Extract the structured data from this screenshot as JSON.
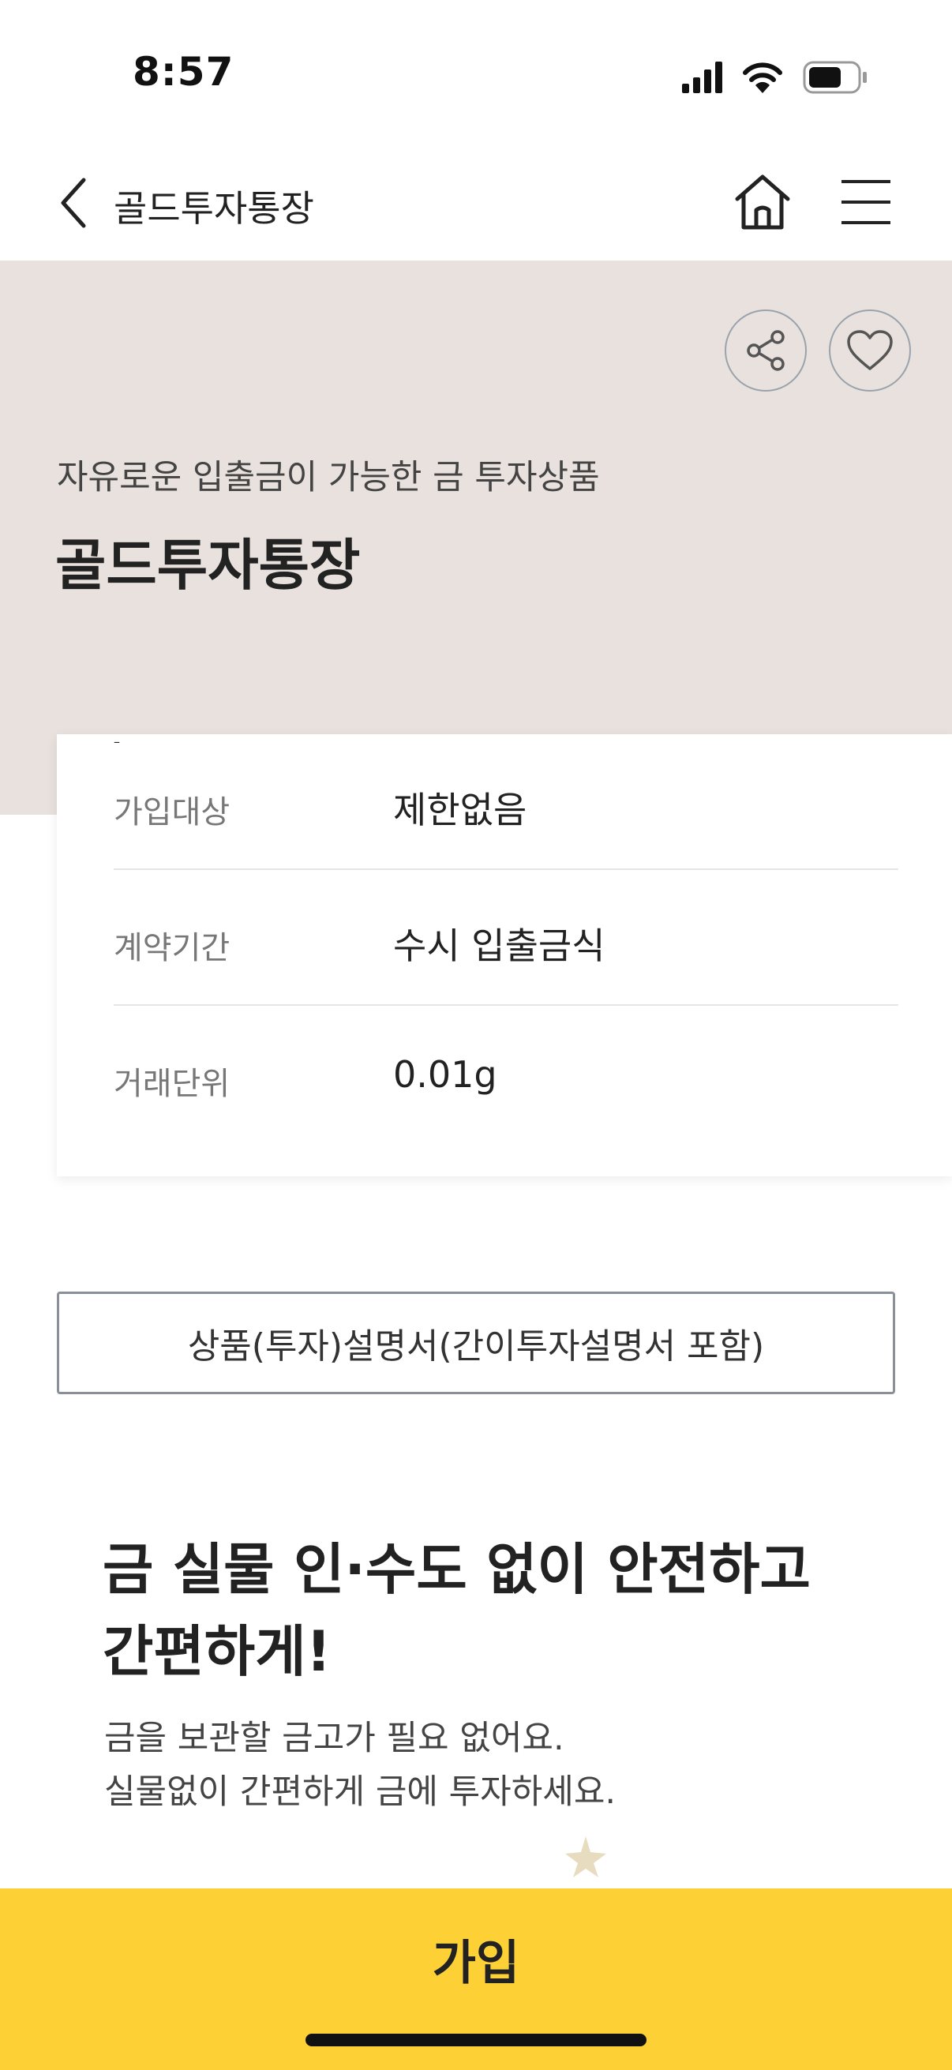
{
  "status_bar": {
    "time": "8:57",
    "icons": [
      "signal-icon",
      "wifi-icon",
      "battery-icon"
    ]
  },
  "nav": {
    "title": "골드투자통장",
    "icons": [
      "back-chevron-icon",
      "home-icon",
      "hamburger-menu-icon"
    ]
  },
  "hero": {
    "subtitle": "자유로운 입출금이 가능한 금 투자상품",
    "title": "골드투자통장",
    "background_color": "#e8e1dd",
    "actions": [
      "share-icon",
      "heart-icon"
    ]
  },
  "info": {
    "rows": [
      {
        "label": "가입대상",
        "value": "제한없음"
      },
      {
        "label": "계약기간",
        "value": "수시 입출금식"
      },
      {
        "label": "거래단위",
        "value": "0.01g"
      }
    ]
  },
  "doc_button": {
    "label": "상품(투자)설명서(간이투자설명서 포함)"
  },
  "promo": {
    "title_line1": "금 실물 인·수도 없이 안전하고",
    "title_line2": "간편하게!",
    "desc_line1": "금을 보관할 금고가 필요 없어요.",
    "desc_line2": "실물없이 간편하게 금에 투자하세요."
  },
  "cta": {
    "label": "가입",
    "color": "#fdd035"
  }
}
